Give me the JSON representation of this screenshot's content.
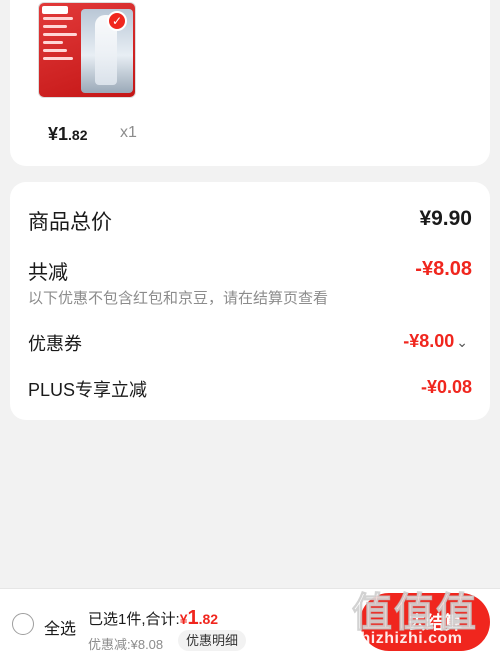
{
  "product": {
    "price_main": "¥1",
    "price_decimal": ".82",
    "quantity": "x1",
    "badge_icon": "check-icon"
  },
  "summary": {
    "total_label": "商品总价",
    "total_value": "¥9.90",
    "cut_label": "共减",
    "cut_value": "-¥8.08",
    "note": "以下优惠不包含红包和京豆，请在结算页查看",
    "coupon_label": "优惠券",
    "coupon_value": "-¥8.00",
    "plus_label": "PLUS专享立减",
    "plus_value": "-¥0.08"
  },
  "bottom": {
    "select_all": "全选",
    "selected_text": "已选1件,合计:",
    "sum_currency": "¥",
    "sum_int": "1",
    "sum_decimal": ".82",
    "discount_text": "优惠减:¥8.08",
    "detail_button": "优惠明细",
    "checkout_button": "去结算"
  },
  "watermark": {
    "glyphs": "值值值",
    "url": "zhizhizhi.com"
  },
  "colors": {
    "accent": "#f0261e",
    "background": "#f2f2f2",
    "muted_text": "#8c8c8c"
  }
}
